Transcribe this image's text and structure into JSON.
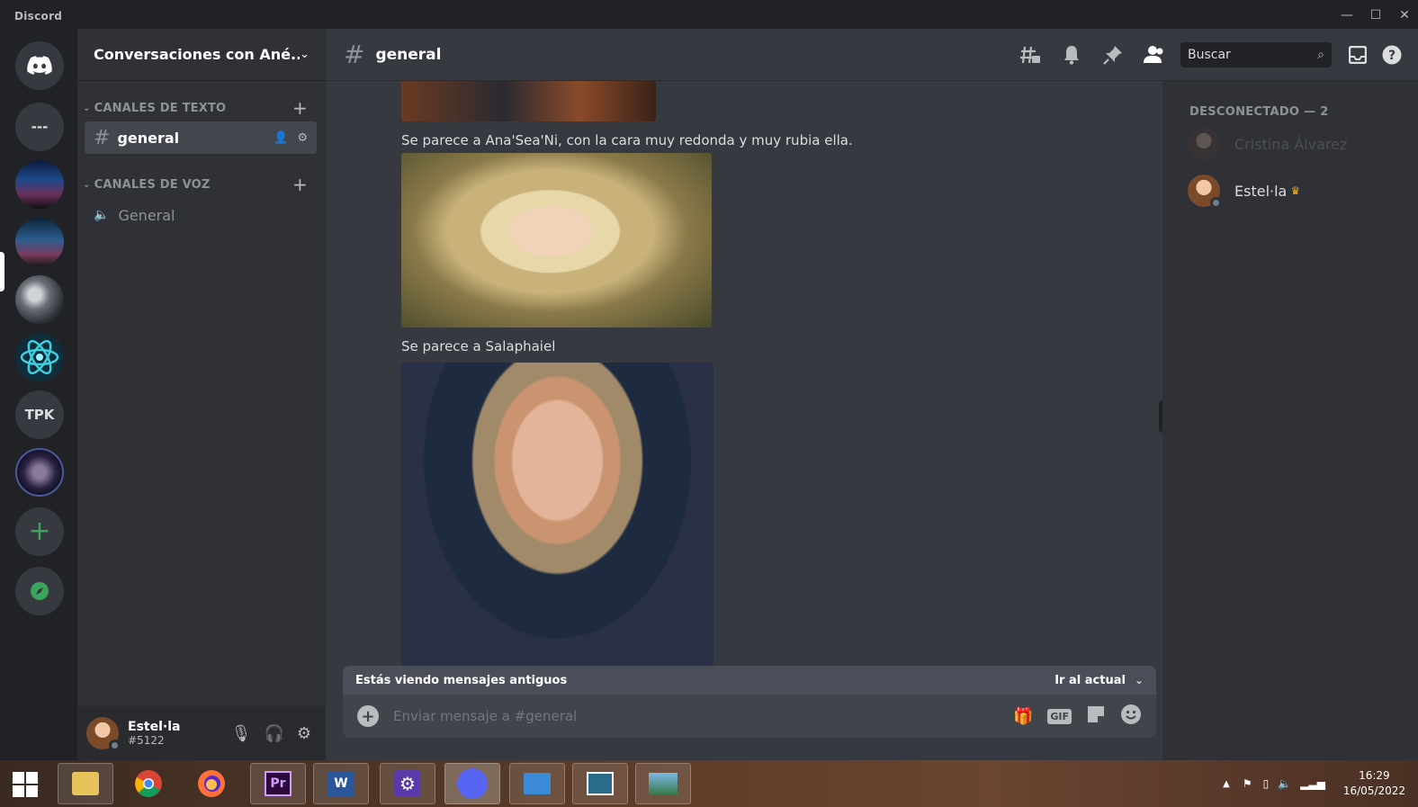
{
  "window": {
    "title": "Discord"
  },
  "servers": [
    {
      "name": "home",
      "kind": "discord-logo"
    },
    {
      "name": "folder",
      "label": "---"
    },
    {
      "name": "server-1",
      "kind": "image"
    },
    {
      "name": "server-2",
      "kind": "image"
    },
    {
      "name": "server-3",
      "kind": "image"
    },
    {
      "name": "server-4",
      "kind": "image"
    },
    {
      "name": "server-5",
      "label": "TPK"
    },
    {
      "name": "server-6",
      "kind": "image"
    },
    {
      "name": "add-server",
      "label": "+"
    },
    {
      "name": "explore",
      "kind": "compass"
    }
  ],
  "guild": {
    "name": "Conversaciones con Ané...",
    "text_category": "CANALES DE TEXTO",
    "voice_category": "CANALES DE VOZ",
    "text_channels": [
      {
        "label": "general"
      }
    ],
    "voice_channels": [
      {
        "label": "General"
      }
    ]
  },
  "user": {
    "name": "Estel·la",
    "tag": "#5122"
  },
  "channel": {
    "title": "general",
    "search_placeholder": "Buscar"
  },
  "messages": [
    {
      "text": "Se parece a Ana'Sea'Ni, con la cara muy redonda y muy rubia ella."
    },
    {
      "text": "Se parece a Salaphaiel"
    }
  ],
  "old_messages_bar": {
    "left": "Estás viendo mensajes antiguos",
    "right": "Ir al actual"
  },
  "composer": {
    "placeholder": "Enviar mensaje a #general",
    "gif_label": "GIF"
  },
  "members": {
    "section": "DESCONECTADO — 2",
    "list": [
      {
        "name": "Cristina Álvarez",
        "muted": true
      },
      {
        "name": "Estel·la",
        "owner": true
      }
    ]
  },
  "taskbar": {
    "time": "16:29",
    "date": "16/05/2022",
    "apps": [
      "file-explorer",
      "chrome",
      "firefox",
      "premiere",
      "word",
      "settings",
      "discord",
      "remote-desktop",
      "photos",
      "image-viewer"
    ]
  },
  "colors": {
    "accent": "#5865f2",
    "online_green": "#3ba55c",
    "crown": "#faa81a"
  }
}
